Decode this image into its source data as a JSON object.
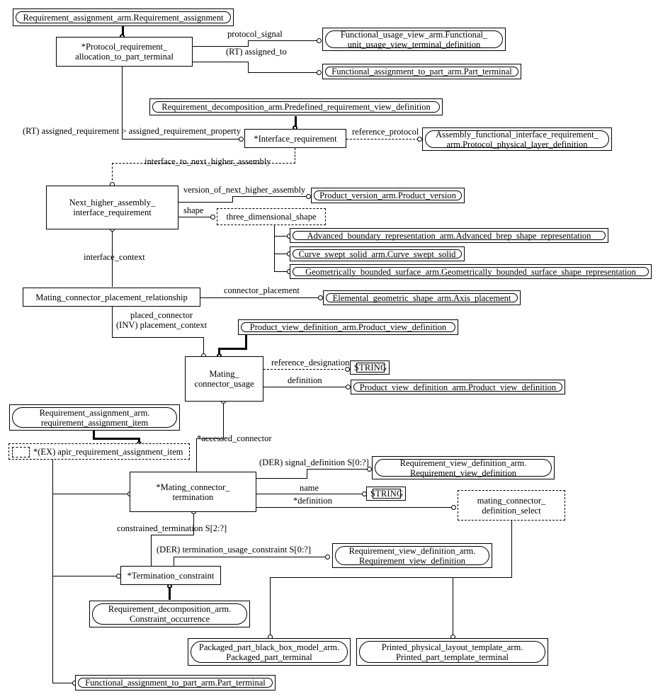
{
  "diagram": {
    "kind": "EXPRESS-G entity-level diagram",
    "nodes": {
      "requirement_assignment": "Requirement_assignment_arm.Requirement_assignment",
      "protocol_requirement_allocation": "*Protocol_requirement_\nallocation_to_part_terminal",
      "functional_unit_usage_view_terminal_definition": "Functional_usage_view_arm.Functional_\nunit_usage_view_terminal_definition",
      "part_terminal_top": "Functional_assignment_to_part_arm.Part_terminal",
      "predefined_requirement_view_definition": "Requirement_decomposition_arm.Predefined_requirement_view_definition",
      "interface_requirement": "*Interface_requirement",
      "protocol_physical_layer_definition": "Assembly_functional_interface_requirement_\narm.Protocol_physical_layer_definition",
      "next_higher_assembly_interface_requirement": "Next_higher_assembly_\ninterface_requirement",
      "product_version": "Product_version_arm.Product_version",
      "three_dimensional_shape": "three_dimensional_shape",
      "advanced_brep_shape_representation": "Advanced_boundary_representation_arm.Advanced_brep_shape_representation",
      "curve_swept_solid": "Curve_swept_solid_arm.Curve_swept_solid",
      "geometrically_bounded_surface_shape_representation": "Geometrically_bounded_surface_arm.Geometrically_bounded_surface_shape_representation",
      "mating_connector_placement_relationship": "Mating_connector_placement_relationship",
      "axis_placement": "Elemental_geometric_shape_arm.Axis_placement",
      "product_view_definition_super": "Product_view_definition_arm.Product_view_definition",
      "mating_connector_usage": "Mating_\nconnector_usage",
      "string_reference_designation": "STRING",
      "product_view_definition_def": "Product_view_definition_arm.Product_view_definition",
      "requirement_assignment_item": "Requirement_assignment_arm.\nrequirement_assignment_item",
      "apir_requirement_assignment_item": "*(EX) apir_requirement_assignment_item",
      "mating_connector_termination": "*Mating_connector_\ntermination",
      "requirement_view_definition_signal": "Requirement_view_definition_arm.\nRequirement_view_definition",
      "string_name": "STRING",
      "mating_connector_definition_select": "mating_connector_\ndefinition_select",
      "termination_constraint": "*Termination_constraint",
      "requirement_view_definition_usage": "Requirement_view_definition_arm.\nRequirement_view_definition",
      "constraint_occurrence": "Requirement_decomposition_arm.\nConstraint_occurrence",
      "packaged_part_terminal": "Packaged_part_black_box_model_arm.\nPackaged_part_terminal",
      "printed_part_template_terminal": "Printed_physical_layout_template_arm.\nPrinted_part_template_terminal",
      "part_terminal_bottom": "Functional_assignment_to_part_arm.Part_terminal"
    },
    "edge_labels": {
      "protocol_signal": "protocol_signal",
      "rt_assigned_to": "(RT) assigned_to",
      "rt_assigned_requirement": "(RT) assigned_requirement > assigned_requirement_property",
      "reference_protocol": "reference_protocol",
      "interface_to_next_higher_assembly": "interface_to_next_higher_assembly",
      "version_of_next_higher_assembly": "version_of_next_higher_assembly",
      "shape": "shape",
      "interface_context": "interface_context",
      "connector_placement": "connector_placement",
      "placed_connector": "placed_connector\n(INV) placement_context",
      "reference_designation": "reference_designation",
      "definition": "definition",
      "accessed_connector": "*accessed_connector",
      "der_signal_definition": "(DER) signal_definition S[0:?]",
      "name": "name",
      "star_definition": "*definition",
      "constrained_termination": "constrained_termination S[2:?]",
      "der_termination_usage_constraint": "(DER) termination_usage_constraint S[0:?]"
    }
  }
}
